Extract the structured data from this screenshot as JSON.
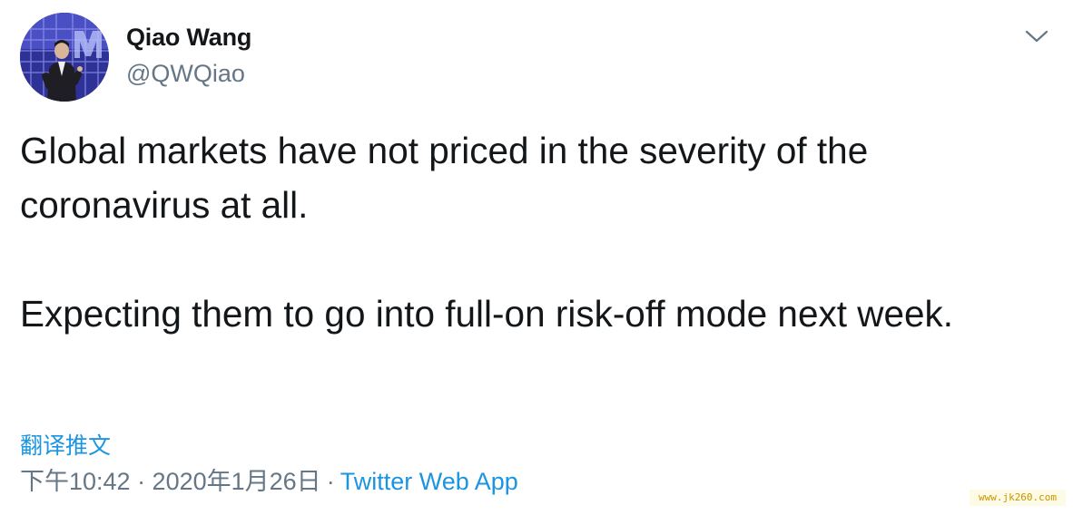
{
  "tweet": {
    "author": {
      "display_name": "Qiao Wang",
      "handle": "@QWQiao"
    },
    "menu_icon": "chevron-down-icon",
    "text_paragraphs": [
      "Global markets have not priced in the severity of the coronavirus at all.",
      "Expecting them to go into full-on risk-off mode next week."
    ],
    "translate_label": "翻译推文",
    "timestamp": "下午10:42 · 2020年1月26日",
    "separator": "·",
    "source": "Twitter Web App"
  },
  "watermark": "www.jk260.com",
  "colors": {
    "text_primary": "#14171a",
    "text_secondary": "#657786",
    "link": "#1b95e0",
    "watermark_text": "#c89400"
  }
}
